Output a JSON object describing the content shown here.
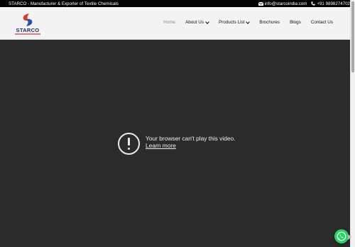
{
  "topbar": {
    "tagline": "STARCO - Manufacturer & Exporter of Textile Chemicals",
    "email": "info@starcoindia.com",
    "phone": "+91 9898274702"
  },
  "brand": {
    "name": "STARCO",
    "colors": {
      "red": "#d93a35",
      "blue": "#2b4fa8",
      "navy": "#1f2a5a"
    }
  },
  "nav": {
    "items": [
      {
        "label": "Home",
        "active": true,
        "has_dropdown": false
      },
      {
        "label": "About Us",
        "active": false,
        "has_dropdown": true
      },
      {
        "label": "Products List",
        "active": false,
        "has_dropdown": true
      },
      {
        "label": "Brochures",
        "active": false,
        "has_dropdown": false
      },
      {
        "label": "Blogs",
        "active": false,
        "has_dropdown": false
      },
      {
        "label": "Contact Us",
        "active": false,
        "has_dropdown": false
      }
    ]
  },
  "video": {
    "error_message": "Your browser can't play this video.",
    "learn_more": "Learn more"
  },
  "widgets": {
    "whatsapp_icon": "whatsapp-icon",
    "whatsapp_color": "#25d366"
  }
}
